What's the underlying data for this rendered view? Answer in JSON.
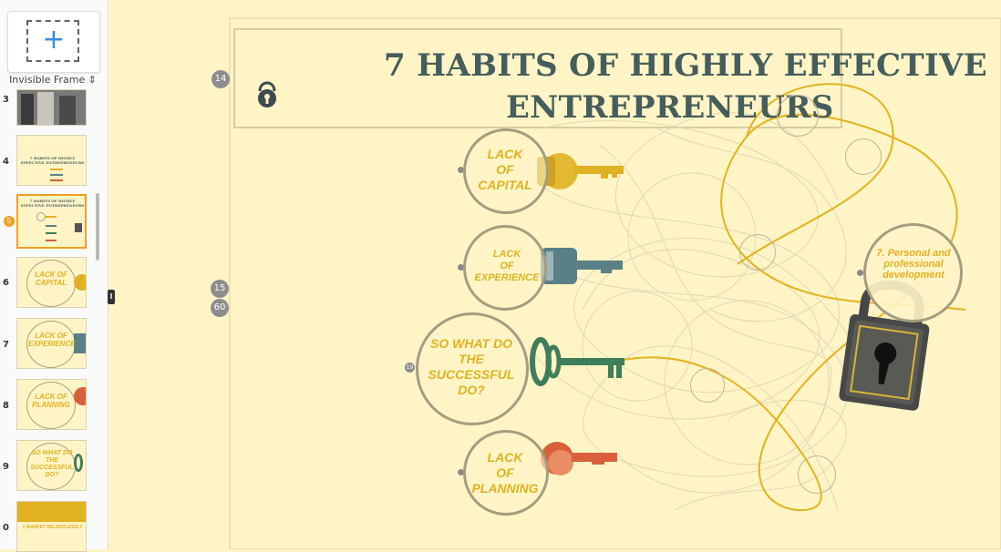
{
  "sidebar": {
    "add_frame_symbol": "+",
    "frame_type": "Invisible Frame ⇕",
    "thumbnails": [
      {
        "number": "3",
        "label": ""
      },
      {
        "number": "4",
        "label": "7 HABITS OF HIGHLY EFFECTIVE ENTREPRENEURS"
      },
      {
        "number": "5",
        "label": "7 HABITS OF HIGHLY EFFECTIVE ENTREPRENEURS"
      },
      {
        "number": "6",
        "label": "LACK OF CAPITAL"
      },
      {
        "number": "7",
        "label": "LACK OF EXPERIENCE"
      },
      {
        "number": "8",
        "label": "LACK OF PLANNING"
      },
      {
        "number": "9",
        "label": "SO WHAT DO THE SUCCESSFUL DO?"
      },
      {
        "number": "0",
        "label": "1 MARKET RELENTLESSLY"
      }
    ]
  },
  "canvas": {
    "title_line1": "7 HABITS OF HIGHLY EFFECTIVE",
    "title_line2": "ENTREPRENEURS",
    "badges": {
      "top": "14",
      "mid1": "15",
      "mid2": "60"
    },
    "topics": {
      "capital": [
        "LACK",
        "OF",
        "CAPITAL"
      ],
      "experience": [
        "LACK",
        "OF",
        "EXPERIENCE"
      ],
      "successful": [
        "SO WHAT DO",
        "THE",
        "SUCCESSFUL",
        "DO?"
      ],
      "planning": [
        "LACK",
        "OF",
        "PLANNING"
      ],
      "personal": [
        "7. Personal and",
        "professional",
        "development"
      ]
    },
    "key_colors": {
      "gold": "#e0b122",
      "teal": "#5b7f86",
      "green": "#3f7d5b",
      "orange": "#d9603a"
    }
  }
}
